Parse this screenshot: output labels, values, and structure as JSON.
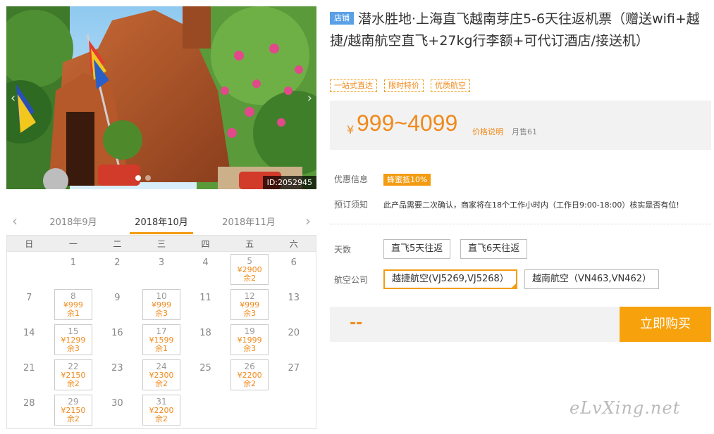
{
  "photo": {
    "id_label": "ID:2052945",
    "prev": "‹",
    "next": "›"
  },
  "calendar": {
    "prev_arrow": "‹",
    "next_arrow": "›",
    "months": [
      "2018年9月",
      "2018年10月",
      "2018年11月"
    ],
    "active_month_index": 1,
    "weekdays": [
      "日",
      "一",
      "二",
      "三",
      "四",
      "五",
      "六"
    ],
    "days": [
      {
        "d": "",
        "p": "",
        "s": ""
      },
      {
        "d": "1",
        "p": "",
        "s": ""
      },
      {
        "d": "2",
        "p": "",
        "s": ""
      },
      {
        "d": "3",
        "p": "",
        "s": ""
      },
      {
        "d": "4",
        "p": "",
        "s": ""
      },
      {
        "d": "5",
        "p": "¥2900",
        "s": "余2"
      },
      {
        "d": "6",
        "p": "",
        "s": ""
      },
      {
        "d": "7",
        "p": "",
        "s": ""
      },
      {
        "d": "8",
        "p": "¥999",
        "s": "余1"
      },
      {
        "d": "9",
        "p": "",
        "s": ""
      },
      {
        "d": "10",
        "p": "¥999",
        "s": "余3"
      },
      {
        "d": "11",
        "p": "",
        "s": ""
      },
      {
        "d": "12",
        "p": "¥999",
        "s": "余3"
      },
      {
        "d": "13",
        "p": "",
        "s": ""
      },
      {
        "d": "14",
        "p": "",
        "s": ""
      },
      {
        "d": "15",
        "p": "¥1299",
        "s": "余3"
      },
      {
        "d": "16",
        "p": "",
        "s": ""
      },
      {
        "d": "17",
        "p": "¥1599",
        "s": "余1"
      },
      {
        "d": "18",
        "p": "",
        "s": ""
      },
      {
        "d": "19",
        "p": "¥1999",
        "s": "余3"
      },
      {
        "d": "20",
        "p": "",
        "s": ""
      },
      {
        "d": "21",
        "p": "",
        "s": ""
      },
      {
        "d": "22",
        "p": "¥2150",
        "s": "余2"
      },
      {
        "d": "23",
        "p": "",
        "s": ""
      },
      {
        "d": "24",
        "p": "¥2300",
        "s": "余2"
      },
      {
        "d": "25",
        "p": "",
        "s": ""
      },
      {
        "d": "26",
        "p": "¥2200",
        "s": "余2"
      },
      {
        "d": "27",
        "p": "",
        "s": ""
      },
      {
        "d": "28",
        "p": "",
        "s": ""
      },
      {
        "d": "29",
        "p": "¥2150",
        "s": "余2"
      },
      {
        "d": "30",
        "p": "",
        "s": ""
      },
      {
        "d": "31",
        "p": "¥2200",
        "s": "余2"
      }
    ]
  },
  "product": {
    "shop_tag": "店铺",
    "title": "潜水胜地·上海直飞越南芽庄5-6天往返机票（赠送wifi+越捷/越南航空直飞+27kg行李额+可代订酒店/接送机）",
    "labels": [
      "一站式直达",
      "限时特价",
      "优质航空"
    ],
    "currency": "¥",
    "price": "999~4099",
    "price_explain": "价格说明",
    "monthly_sales": "月售61"
  },
  "info": {
    "discount_label": "优惠信息",
    "discount_badge": "蜂蜜抵10%",
    "booking_label": "预订须知",
    "booking_note": "此产品需要二次确认，商家将在18个工作小时内（工作日9:00-18:00）核实是否有位!"
  },
  "options": {
    "days_label": "天数",
    "days": [
      "直飞5天往返",
      "直飞6天往返"
    ],
    "airline_label": "航空公司",
    "airlines": [
      "越捷航空(VJ5269,VJ5268）",
      "越南航空（VN463,VN462）"
    ],
    "selected_airline": 0
  },
  "buy": {
    "total": "--",
    "button": "立即购买"
  },
  "watermark": "eLvXing.net"
}
